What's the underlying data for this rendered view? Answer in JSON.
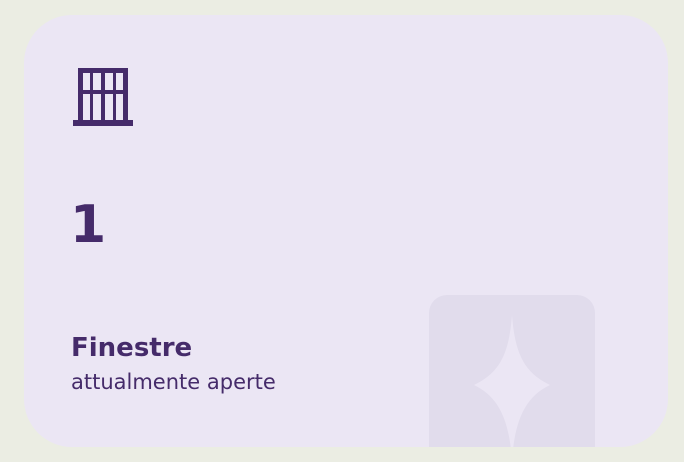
{
  "tile": {
    "icon": "window-icon",
    "count": "1",
    "title": "Finestre",
    "subtitle": "attualmente aperte"
  },
  "colors": {
    "background": "#ebede3",
    "card": "#ebe6f4",
    "accent": "#452b6a",
    "decoration": "#e1dcec"
  },
  "decoration_icon": "sparkle-icon"
}
